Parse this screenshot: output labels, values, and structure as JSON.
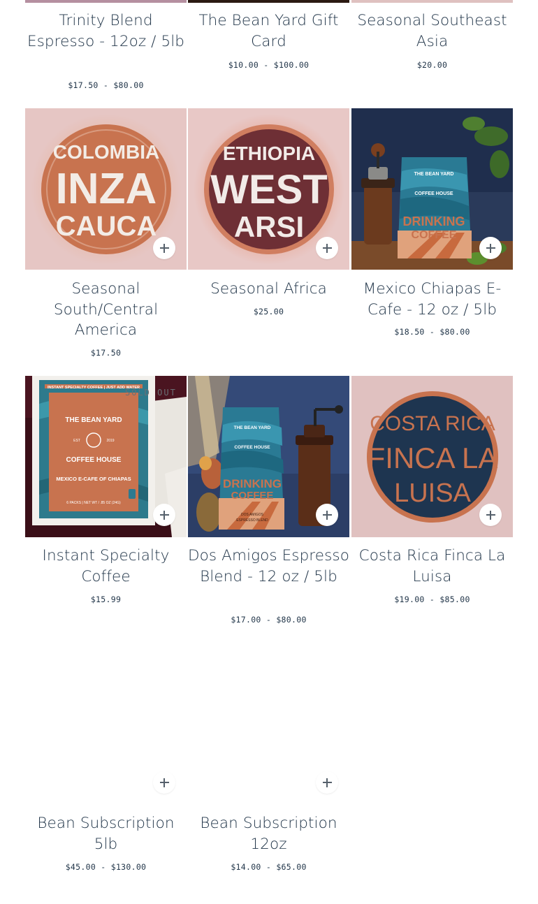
{
  "products": [
    {
      "title": "Trinity Blend Espresso - 12oz / 5lb",
      "price": "$17.50 - $80.00",
      "image": "none",
      "strip_color": "#b58fa0"
    },
    {
      "title": "The Bean Yard Gift Card",
      "price": "$10.00 - $100.00",
      "image": "none",
      "strip_color": "#2b1a12"
    },
    {
      "title": "Seasonal Southeast Asia",
      "price": "$20.00",
      "image": "none",
      "strip_color": "#dfc1c0"
    },
    {
      "title": "Seasonal South/Central America",
      "price": "$17.50",
      "image": "colombia-label",
      "label_lines": [
        "COLOMBIA",
        "INZA",
        "CAUCA"
      ]
    },
    {
      "title": "Seasonal Africa",
      "price": "$25.00",
      "image": "ethiopia-label",
      "label_lines": [
        "ETHIOPIA",
        "WEST",
        "ARSI"
      ]
    },
    {
      "title": "Mexico Chiapas E-Cafe - 12 oz / 5lb",
      "price": "$18.50 - $80.00",
      "image": "bag-photo",
      "bag_lines": [
        "THE BEAN YARD",
        "COFFEE HOUSE",
        "DRINKING",
        "COFFEE"
      ]
    },
    {
      "title": "Instant Specialty Coffee",
      "price": "$15.99",
      "image": "instant-box",
      "badge": "SOLD OUT",
      "box_lines": [
        "INSTANT SPECIALTY COFFEE | JUST ADD WATER",
        "THE BEAN YARD",
        "EST",
        "2019",
        "COFFEE HOUSE",
        "MEXICO E-CAFE OF CHIAPAS",
        "6 PACKS | NET WT / .85 OZ (24G)"
      ]
    },
    {
      "title": "Dos Amigos Espresso Blend - 12 oz / 5lb",
      "price": "$17.00 - $80.00",
      "image": "bag-grinder",
      "bag_lines": [
        "THE BEAN YARD",
        "COFFEE HOUSE",
        "DRINKING",
        "COFFEE",
        "DOS AMIGOS",
        "ESPRESSO BLEND"
      ]
    },
    {
      "title": "Costa Rica Finca La Luisa",
      "price": "$19.00 - $85.00",
      "image": "costarica-label",
      "label_lines": [
        "COSTA RICA",
        "FINCA LA",
        "LUISA"
      ]
    },
    {
      "title": "Bean Subscription 5lb",
      "price": "$45.00 - $130.00",
      "image": "blank"
    },
    {
      "title": "Bean Subscription 12oz",
      "price": "$14.00 - $65.00",
      "image": "blank"
    }
  ],
  "colors": {
    "text": "#1f3347",
    "pink_bg": "#e3c4c2",
    "terracotta": "#c8734f",
    "maroon": "#6e2f35",
    "navy": "#1e3550"
  }
}
